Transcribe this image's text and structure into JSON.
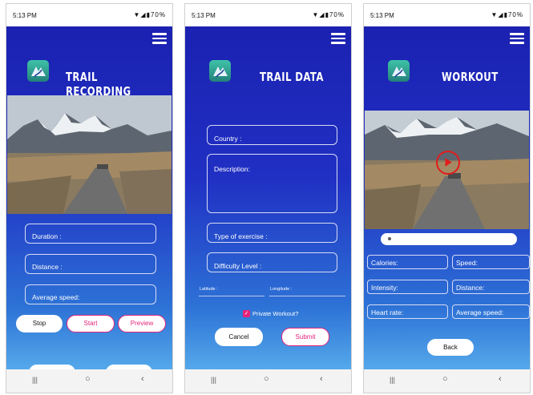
{
  "status": {
    "time": "5:13 PM",
    "battery": "70%"
  },
  "screen1": {
    "title": "TRAIL RECORDING",
    "fields": {
      "duration": "Duration :",
      "distance": "Distance :",
      "average_speed": "Average speed:"
    },
    "buttons": {
      "stop": "Stop",
      "start": "Start",
      "preview": "Preview"
    }
  },
  "screen2": {
    "title": "TRAIL DATA",
    "fields": {
      "country": "Country :",
      "description": "Description:",
      "type_of_exercise": "Type of exercise :",
      "difficulty_level": "Difficulty Level :"
    },
    "latitude": "Latitude :",
    "longitude": "Longitude :",
    "private_workout": "Private Workout?",
    "buttons": {
      "cancel": "Cancel",
      "submit": "Submit"
    }
  },
  "screen3": {
    "title": "WORKOUT",
    "stats": {
      "calories": "Calories:",
      "speed": "Speed:",
      "intensity": "Intensity:",
      "distance": "Distance:",
      "heart_rate": "Heart rate:",
      "average_speed": "Average speed:"
    },
    "buttons": {
      "back": "Back"
    }
  },
  "colors": {
    "accent_pink": "#e6237a",
    "play_red": "#e31c1c",
    "brand_blue": "#1a1fae"
  },
  "icons": [
    "hamburger-menu-icon",
    "app-logo-icon",
    "play-icon",
    "recents-icon",
    "home-icon",
    "back-icon",
    "wifi-icon",
    "signal-icon",
    "battery-icon",
    "checkbox-icon"
  ]
}
